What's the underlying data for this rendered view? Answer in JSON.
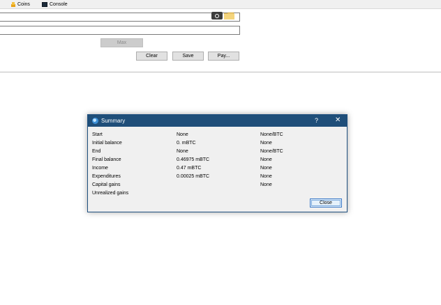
{
  "tabs": {
    "coins_label": "Coins",
    "console_label": "Console"
  },
  "send": {
    "max_label": "Max",
    "clear_label": "Clear",
    "save_label": "Save",
    "pay_label": "Pay..."
  },
  "summary_dialog": {
    "title": "Summary",
    "help_glyph": "?",
    "close_glyph": "✕",
    "rows": [
      {
        "label": "Start",
        "value": "None",
        "extra": "None/BTC"
      },
      {
        "label": "Initial balance",
        "value": "0. mBTC",
        "extra": "None"
      },
      {
        "label": "End",
        "value": "None",
        "extra": "None/BTC"
      },
      {
        "label": "Final balance",
        "value": "0.46975 mBTC",
        "extra": "None"
      },
      {
        "label": "Income",
        "value": "0.47 mBTC",
        "extra": "None"
      },
      {
        "label": "Expenditures",
        "value": "0.00025 mBTC",
        "extra": "None"
      },
      {
        "label": "Capital gains",
        "value": "",
        "extra": "None"
      },
      {
        "label": "Unrealized gains",
        "value": "",
        "extra": ""
      }
    ],
    "close_button_label": "Close"
  },
  "colors": {
    "title_bar": "#1f4e79",
    "dialog_bg": "#f0f0f0",
    "button_bg": "#e1e1e1"
  }
}
